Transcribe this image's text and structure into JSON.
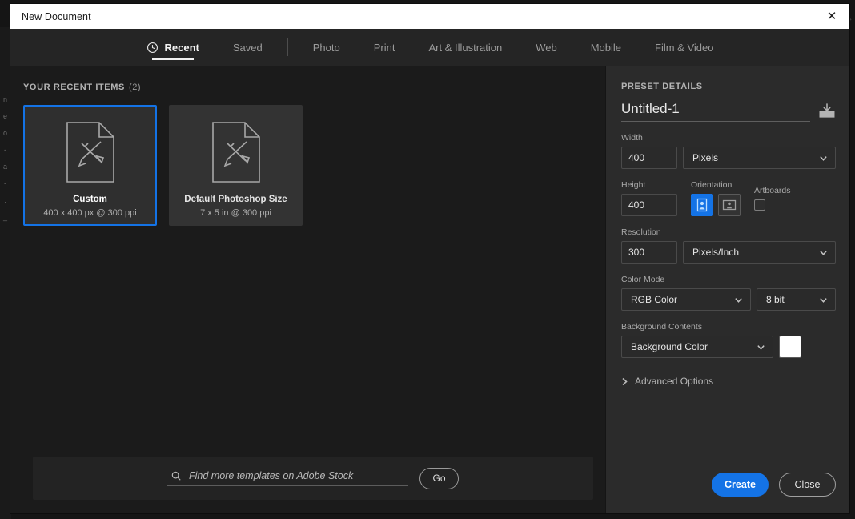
{
  "window": {
    "title": "New Document",
    "close_icon": "close-icon"
  },
  "tabs": [
    {
      "label": "Recent",
      "icon": "clock-icon",
      "active": true
    },
    {
      "label": "Saved",
      "active": false
    },
    {
      "label": "Photo",
      "active": false
    },
    {
      "label": "Print",
      "active": false
    },
    {
      "label": "Art & Illustration",
      "active": false
    },
    {
      "label": "Web",
      "active": false
    },
    {
      "label": "Mobile",
      "active": false
    },
    {
      "label": "Film & Video",
      "active": false
    }
  ],
  "recent": {
    "heading": "YOUR RECENT ITEMS",
    "count": "(2)",
    "items": [
      {
        "title": "Custom",
        "subtitle": "400 x 400 px @ 300 ppi",
        "selected": true
      },
      {
        "title": "Default Photoshop Size",
        "subtitle": "7 x 5 in @ 300 ppi",
        "selected": false
      }
    ]
  },
  "stock": {
    "placeholder": "Find more templates on Adobe Stock",
    "value": "",
    "go_label": "Go",
    "search_icon": "search-icon"
  },
  "preset": {
    "heading": "PRESET DETAILS",
    "name_value": "Untitled-1",
    "save_icon": "save-preset-icon",
    "width": {
      "label": "Width",
      "value": "400",
      "unit": "Pixels"
    },
    "height": {
      "label": "Height",
      "value": "400"
    },
    "orientation": {
      "label": "Orientation",
      "portrait_active": true
    },
    "artboards": {
      "label": "Artboards",
      "checked": false
    },
    "resolution": {
      "label": "Resolution",
      "value": "300",
      "unit": "Pixels/Inch"
    },
    "color_mode": {
      "label": "Color Mode",
      "value": "RGB Color",
      "depth": "8 bit"
    },
    "background": {
      "label": "Background Contents",
      "value": "Background Color",
      "swatch_color": "#ffffff"
    },
    "advanced_label": "Advanced Options"
  },
  "actions": {
    "create_label": "Create",
    "close_label": "Close"
  },
  "colors": {
    "accent": "#1473e6",
    "titlebar_bg": "#ffffff",
    "panel_bg": "#2b2b2b",
    "content_bg": "#1b1b1b"
  },
  "background_app": {
    "edge_glyphs": [
      "n",
      "e",
      "o",
      "-",
      "a",
      "-",
      ":",
      "_"
    ]
  }
}
